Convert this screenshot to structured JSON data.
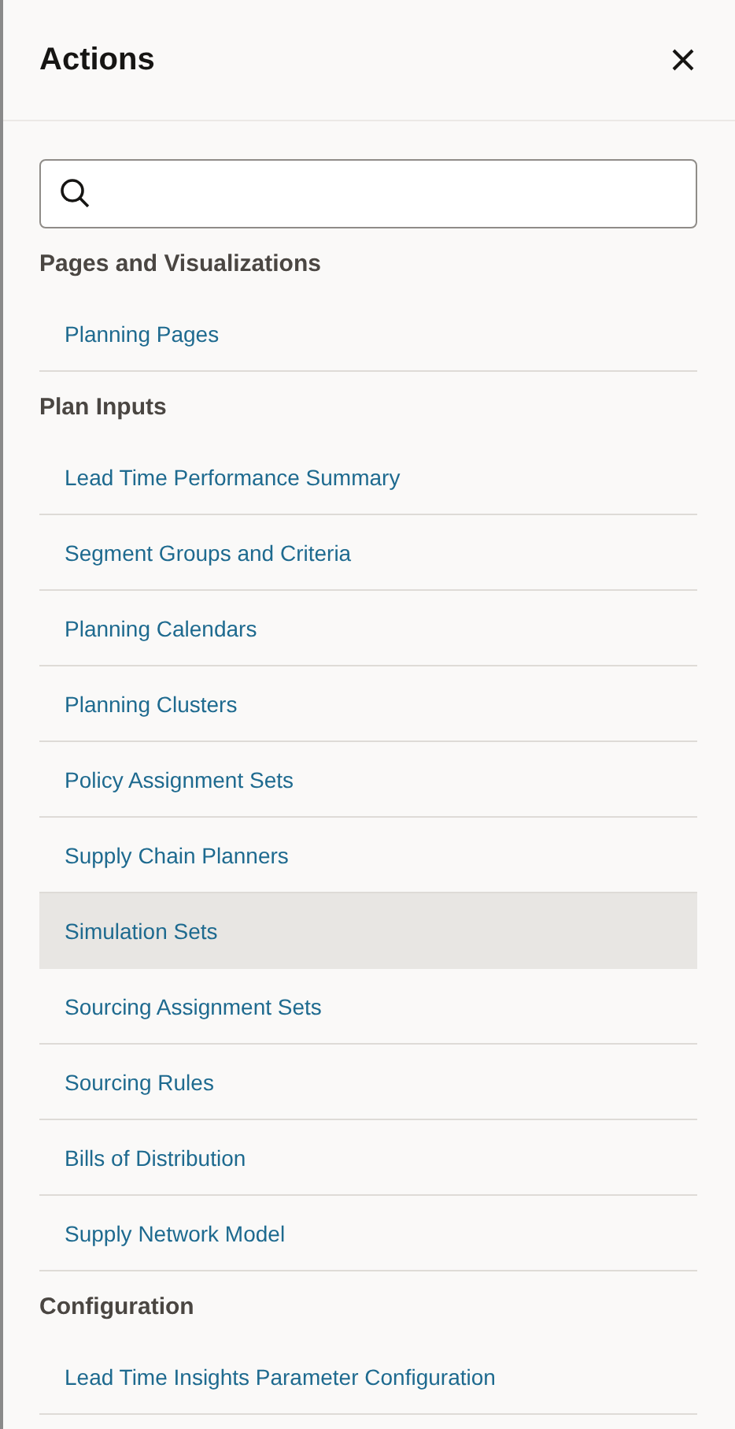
{
  "panel": {
    "title": "Actions"
  },
  "sections": [
    {
      "title": "Pages and Visualizations",
      "items": [
        {
          "label": "Planning Pages",
          "selected": false
        }
      ]
    },
    {
      "title": "Plan Inputs",
      "items": [
        {
          "label": "Lead Time Performance Summary",
          "selected": false
        },
        {
          "label": "Segment Groups and Criteria",
          "selected": false
        },
        {
          "label": "Planning Calendars",
          "selected": false
        },
        {
          "label": "Planning Clusters",
          "selected": false
        },
        {
          "label": "Policy Assignment Sets",
          "selected": false
        },
        {
          "label": "Supply Chain Planners",
          "selected": false
        },
        {
          "label": "Simulation Sets",
          "selected": true
        },
        {
          "label": "Sourcing Assignment Sets",
          "selected": false
        },
        {
          "label": "Sourcing Rules",
          "selected": false
        },
        {
          "label": "Bills of Distribution",
          "selected": false
        },
        {
          "label": "Supply Network Model",
          "selected": false
        }
      ]
    },
    {
      "title": "Configuration",
      "items": [
        {
          "label": "Lead Time Insights Parameter Configuration",
          "selected": false
        }
      ]
    }
  ]
}
